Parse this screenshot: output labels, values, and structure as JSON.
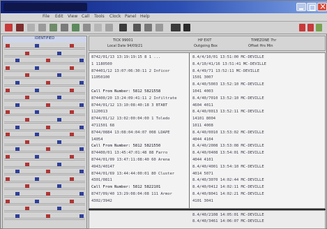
{
  "window": {
    "title_bar_color": "#0c1f7c",
    "close_color": "#d94b3a"
  },
  "menu": {
    "items": [
      "File",
      "Edit",
      "View",
      "Call",
      "Tools",
      "Clock",
      "Panel",
      "Help"
    ]
  },
  "toolbar": {
    "icons": [
      "red-square-icon",
      "pin-icon",
      "folder-icon",
      "print-icon",
      "window-icon",
      "phone-icon",
      "check-icon",
      "arrow-icon",
      "gear-icon",
      "help-icon"
    ]
  },
  "left_panel": {
    "header": "IDENTIFIED",
    "row_count": 24
  },
  "log": {
    "left_entries": [
      "8742/01/13 13:19:19:15  8 1 ...",
      "  1 1180500",
      "874401/12 13:07:06:30:11  2 Inficor",
      "  11050100",
      "",
      "Call From Number: 5812 5821558",
      "874400/20 13:24:09:41:11  2 Infiltrate",
      "8744/01/12 13:10:08:40:18  3 BTABT",
      "  1120013",
      "  8744/01/12 13:02:00:04:00  1 Toledo",
      "  4711501 68",
      "8744/0884 13:08:04:04:07  008 LDAPE",
      "  14054",
      "Call From Number: 5812 5821550",
      "874400/01 13:45:47:01:48 88 Farro",
      "8744/01/09 13:47:11:08:40  60 Arena",
      "  4943/40147",
      "8744/01/69 13:44:44:00:01  80 Cluster",
      "  4301/0811",
      "Call From Number: 5812 5822101",
      "8747/09/40 13:29:08:04:08  111 Armor",
      "  4302/3942"
    ],
    "right_entries": [
      "8.4/4/10/01 13:51:00   MC-DEVILLE",
      "8.4/10/41/16 13:51:41   MC-DEVILLE",
      "  8.4/49/71   13:52:11  MC-DEVILLE",
      "  1501  3007",
      "8.4/40/5003 13:52:10  MC-DEVILLE",
      "  1041 4003",
      "8.4/40/7010 13:52:10  MC-DEVILLE",
      "  4604  4011",
      "8.4/40/0013 13:52:11  MC-DEVILLE",
      "  14101  8004",
      "  1011  4008",
      "8.4/40/0010 13:53:02  MC-DEVILLE",
      "  4044  4104",
      "8.4/40/2008 13:53:08  MC-DEVILLE",
      "8.4/40/0408 13:54:01  MC-DEVILLE",
      "  4044  4101",
      "8.4/40/4001 13:54:10  MC-DEVILLE",
      "  4014  5071",
      "8.4/40/3070 14:02:44  MC-DEVILLE",
      "8.4/40/0412 14:02:11  MC-DEVILLE",
      "8.4/40/8041 14:02:21  MC-DEVILLE",
      "  4101  3041"
    ]
  },
  "footer": {
    "entries": [
      "8.4/40/2108 14:05:01  MC-DEVILLE",
      "8.4/40/3461 14:06:07  MC-DEVILLE"
    ]
  },
  "header_labels": {
    "h1": "TICK  99001",
    "h2": "Local Date  94/09/21",
    "h3": "HP  EXIT",
    "h4": "Outgoing  Box",
    "h5": "TIMEZONE  7hr",
    "h6": "Offset  Hrs  Min"
  }
}
